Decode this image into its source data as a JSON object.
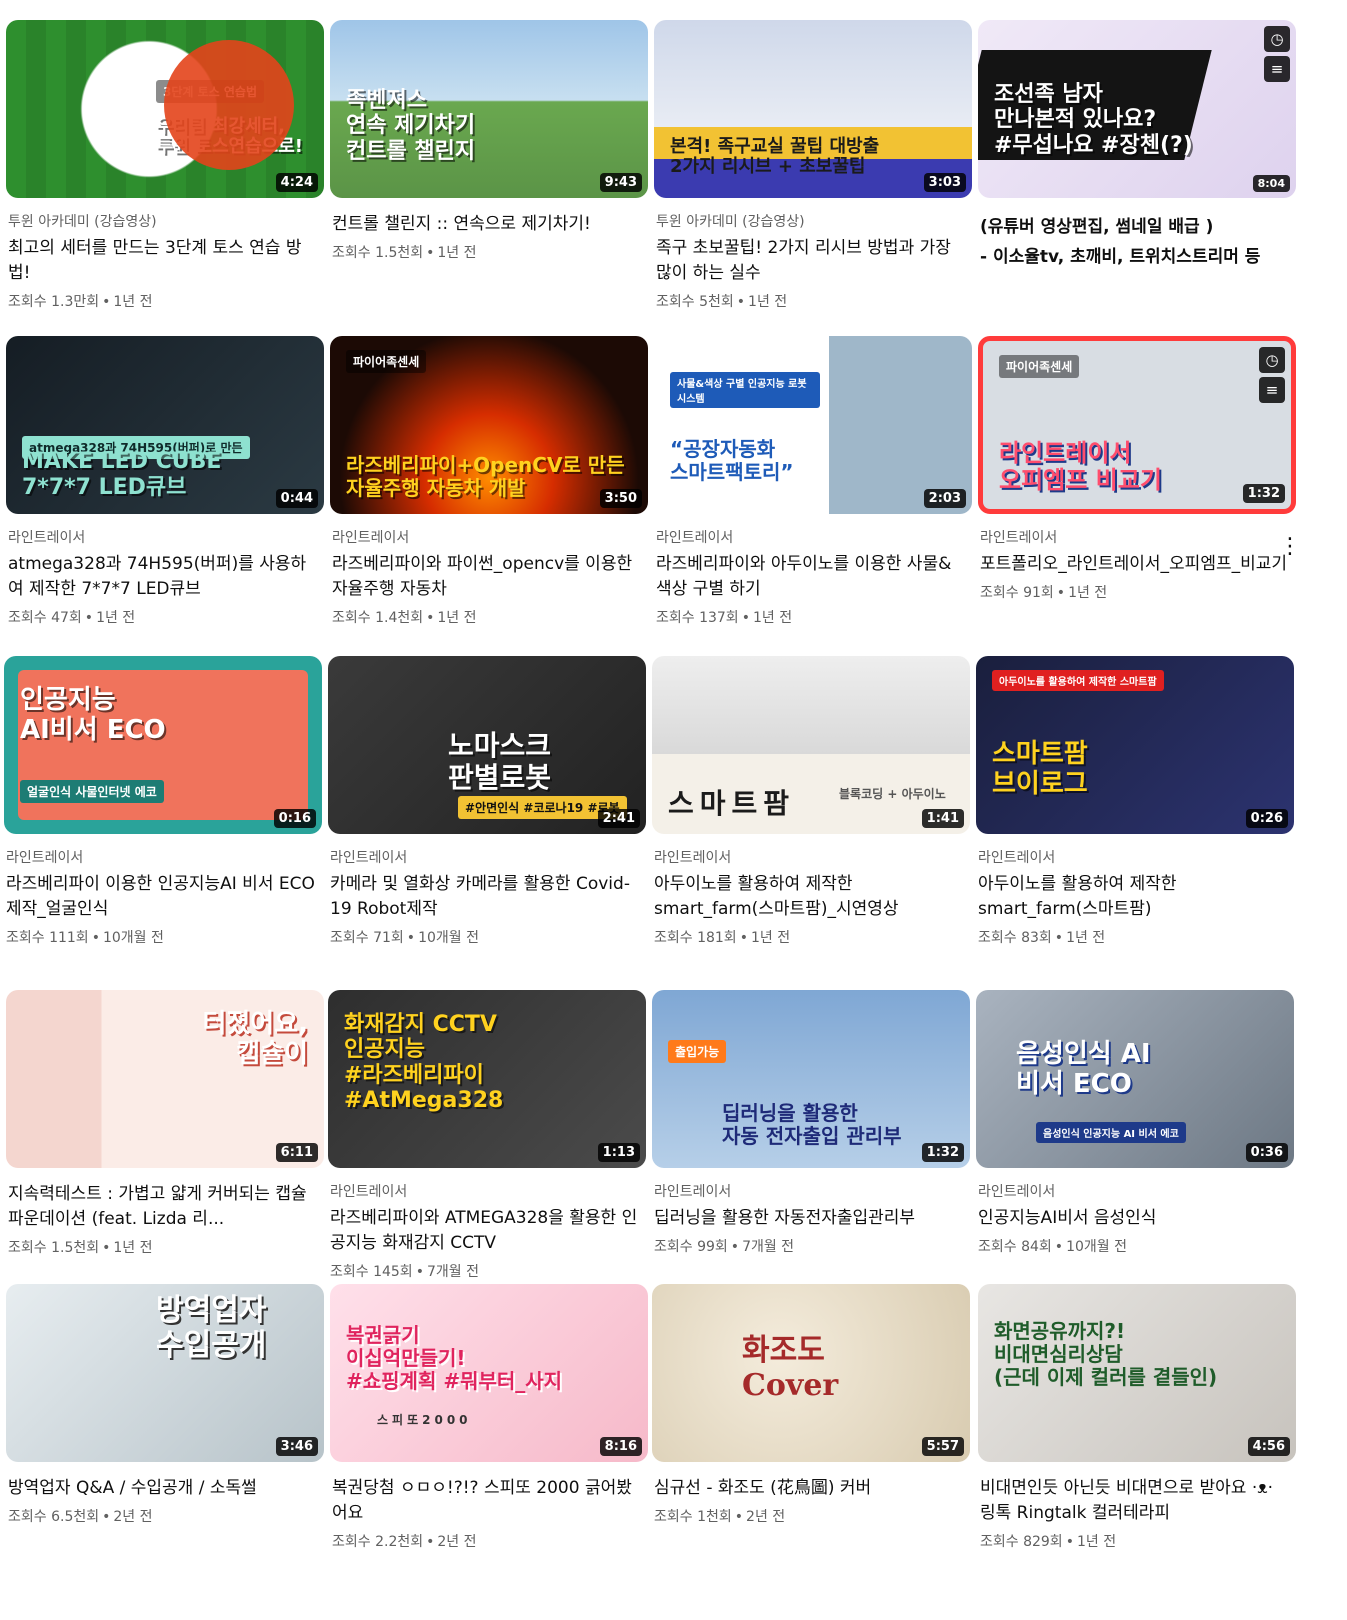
{
  "videos": [
    {
      "channel": "투윈 아카데미 (강습영상)",
      "title": "최고의 세터를 만드는 3단계 토스 연습 방법!",
      "views": "조회수 1.3만회",
      "age": "1년 전",
      "duration": "4:24",
      "thumb": {
        "headline": "우리팀 최강세터,\n투윈 토스연습으로!",
        "sub": "3단계 토스 연습법"
      }
    },
    {
      "channel": "",
      "title": "컨트롤 챌린지 :: 연속으로 제기차기!",
      "views": "조회수 1.5천회",
      "age": "1년 전",
      "duration": "9:43",
      "thumb": {
        "headline": "족벤져스\n연속 제기차기\n컨트롤 챌린지",
        "sub": ""
      }
    },
    {
      "channel": "투윈 아카데미 (강습영상)",
      "title": "족구 초보꿀팁! 2가지 리시브 방법과 가장 많이 하는 실수",
      "views": "조회수 5천회",
      "age": "1년 전",
      "duration": "3:03",
      "thumb": {
        "headline": "본격! 족구교실 꿀팁 대방출\n2가지 리시브 + 초보꿀팁",
        "sub": ""
      }
    },
    {
      "ad": true,
      "title": "(유튜버 영상편집, 썸네일 배급 )",
      "subtitle": "- 이소율tv, 초깨비, 트위치스트리머 등",
      "duration": "8:04",
      "thumb": {
        "headline": "조선족 남자\n만나본적 있나요?\n#무섭나요 #장첸(?)",
        "sub": ""
      }
    },
    {
      "channel": "라인트레이서",
      "title": "atmega328과 74H595(버퍼)를 사용하여 제작한 7*7*7 LED큐브",
      "views": "조회수 47회",
      "age": "1년 전",
      "duration": "0:44",
      "thumb": {
        "headline": "MAKE LED CUBE\n7*7*7 LED큐브",
        "sub": "atmega328과 74H595(버퍼)로 만든"
      }
    },
    {
      "channel": "라인트레이서",
      "title": "라즈베리파이와 파이썬_opencv를 이용한 자율주행 자동차",
      "views": "조회수 1.4천회",
      "age": "1년 전",
      "duration": "3:50",
      "thumb": {
        "headline": "라즈베리파이+OpenCV로 만든\n자율주행 자동차 개발",
        "sub": "파이어족센세"
      }
    },
    {
      "channel": "라인트레이서",
      "title": "라즈베리파이와 아두이노를 이용한 사물&색상 구별 하기",
      "views": "조회수 137회",
      "age": "1년 전",
      "duration": "2:03",
      "thumb": {
        "headline": "“공장자동화\n스마트팩토리”",
        "sub": "사물&색상 구별 인공지능 로봇 시스템"
      }
    },
    {
      "channel": "라인트레이서",
      "title": "포트폴리오_라인트레이서_오피엠프_비교기",
      "views": "조회수 91회",
      "age": "1년 전",
      "duration": "1:32",
      "thumb": {
        "headline": "라인트레이서\n오피엠프 비교기",
        "sub": "파이어족센세"
      }
    },
    {
      "channel": "라인트레이서",
      "title": "라즈베리파이 이용한 인공지능AI 비서 ECO 제작_얼굴인식",
      "views": "조회수 111회",
      "age": "10개월 전",
      "duration": "0:16",
      "thumb": {
        "headline": "인공지능\nAI비서 ECO",
        "sub": "얼굴인식 사물인터넷 에코"
      }
    },
    {
      "channel": "라인트레이서",
      "title": "카메라 및 열화상 카메라를 활용한 Covid-19 Robot제작",
      "views": "조회수 71회",
      "age": "10개월 전",
      "duration": "2:41",
      "thumb": {
        "headline": "노마스크\n판별로봇",
        "sub": "#안면인식 #코로나19 #로봇"
      }
    },
    {
      "channel": "라인트레이서",
      "title": "아두이노를 활용하여 제작한 smart_farm(스마트팜)_시연영상",
      "views": "조회수 181회",
      "age": "1년 전",
      "duration": "1:41",
      "thumb": {
        "headline": "스마트팜",
        "sub": "블록코딩 + 아두이노"
      }
    },
    {
      "channel": "라인트레이서",
      "title": "아두이노를 활용하여 제작한 smart_farm(스마트팜)",
      "views": "조회수 83회",
      "age": "1년 전",
      "duration": "0:26",
      "thumb": {
        "headline": "스마트팜\n브이로그",
        "sub": "아두이노를 활용하여 제작한 스마트팜"
      }
    },
    {
      "channel": "",
      "title": "지속력테스트 : 가볍고 얇게 커버되는 캡슐파운데이션 (feat. Lizda 리...",
      "views": "조회수 1.5천회",
      "age": "1년 전",
      "duration": "6:11",
      "thumb": {
        "headline": "터졌어요,\n캡슐이",
        "sub": ""
      }
    },
    {
      "channel": "라인트레이서",
      "title": "라즈베리파이와 ATMEGA328을 활용한 인공지능 화재감지 CCTV",
      "views": "조회수 145회",
      "age": "7개월 전",
      "duration": "1:13",
      "thumb": {
        "headline": "화재감지 CCTV\n인공지능\n#라즈베리파이 #AtMega328",
        "sub": ""
      }
    },
    {
      "channel": "라인트레이서",
      "title": "딥러닝을 활용한 자동전자출입관리부",
      "views": "조회수 99회",
      "age": "7개월 전",
      "duration": "1:32",
      "thumb": {
        "headline": "딥러닝을 활용한\n자동 전자출입 관리부",
        "sub": "출입가능"
      }
    },
    {
      "channel": "라인트레이서",
      "title": "인공지능AI비서 음성인식",
      "views": "조회수 84회",
      "age": "10개월 전",
      "duration": "0:36",
      "thumb": {
        "headline": "음성인식 AI\n비서 ECO",
        "sub": "음성인식 인공지능 AI 비서 에코"
      }
    },
    {
      "channel": "",
      "title": "방역업자 Q&A / 수입공개 / 소독썰",
      "views": "조회수 6.5천회",
      "age": "2년 전",
      "duration": "3:46",
      "thumb": {
        "headline": "방역업자\n수입공개",
        "sub": ""
      }
    },
    {
      "channel": "",
      "title": "복권당첨 ㅇㅁㅇ!?!? 스피또 2000 긁어봤어요",
      "views": "조회수 2.2천회",
      "age": "2년 전",
      "duration": "8:16",
      "thumb": {
        "headline": "복권긁기\n이십억만들기!\n#쇼핑계획 #뭐부터_사지",
        "sub": "스피또2000"
      }
    },
    {
      "channel": "",
      "title": "심규선 - 화조도 (花鳥圖) 커버",
      "views": "조회수 1천회",
      "age": "2년 전",
      "duration": "5:57",
      "thumb": {
        "headline": "화조도\nCover",
        "sub": ""
      }
    },
    {
      "channel": "",
      "title": "비대면인듯 아닌듯 비대면으로 받아요 ·ᴥ· 링톡 Ringtalk 컬러테라피",
      "views": "조회수 829회",
      "age": "1년 전",
      "duration": "4:56",
      "thumb": {
        "headline": "화면공유까지?!\n비대면심리상담\n(근데 이제 컬러를 곁들인)",
        "sub": ""
      }
    }
  ],
  "ui": {
    "more_icon": "⋮",
    "watch_later_icon": "◷",
    "add_to_queue_icon": "≡",
    "separator": "•"
  }
}
